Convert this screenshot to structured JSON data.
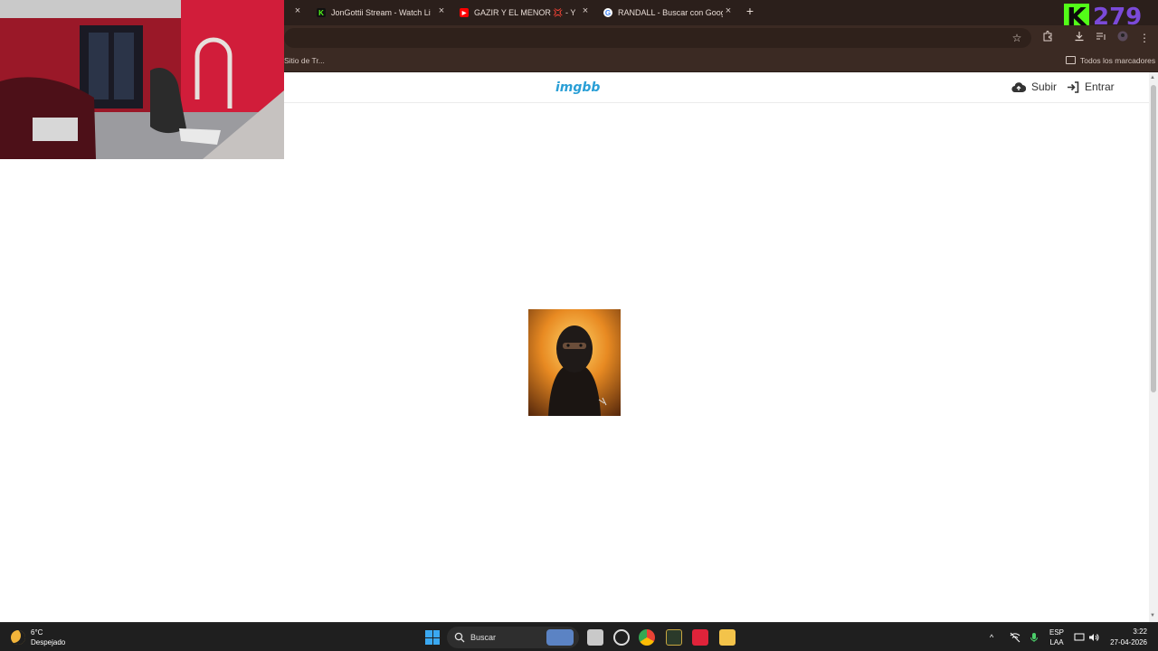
{
  "browser": {
    "tabs": [
      {
        "title": "JonGottii Stream - Watch Live o",
        "favicon": "kick-icon",
        "favicon_color": "#53fc18"
      },
      {
        "title": "GAZIR Y EL MENOR 💢 - YouTu",
        "favicon": "youtube-icon",
        "favicon_color": "#ff0000"
      },
      {
        "title": "RANDALL - Buscar con Google",
        "favicon": "google-icon",
        "favicon_color": "#ffffff"
      }
    ],
    "tab_close_glyph": "×",
    "new_tab_glyph": "+",
    "bookmark_partial": "Sitio de Tr...",
    "all_bookmarks_label": "Todos los marcadores",
    "stream_overlay": {
      "letter": "K",
      "number": "279"
    }
  },
  "site": {
    "logo": "imgbb",
    "upload_label": "Subir",
    "login_label": "Entrar",
    "brand_color": "#2a9fd6"
  },
  "taskbar": {
    "weather_temp": "6°C",
    "weather_desc": "Despejado",
    "search_label": "Buscar",
    "lang_top": "ESP",
    "lang_bottom": "LAA",
    "time": "3:22",
    "date": "27-04-2026"
  }
}
